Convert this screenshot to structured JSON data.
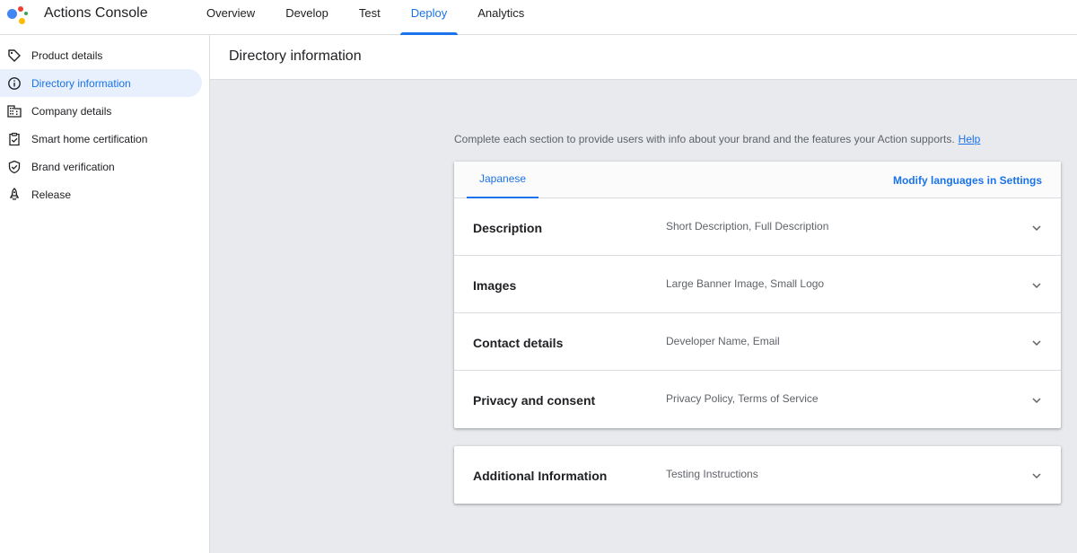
{
  "app": {
    "title": "Actions Console"
  },
  "nav": {
    "tabs": [
      {
        "label": "Overview"
      },
      {
        "label": "Develop"
      },
      {
        "label": "Test"
      },
      {
        "label": "Deploy",
        "active": true
      },
      {
        "label": "Analytics"
      }
    ]
  },
  "sidebar": {
    "items": [
      {
        "label": "Product details",
        "icon": "tag-icon"
      },
      {
        "label": "Directory information",
        "icon": "info-icon",
        "active": true
      },
      {
        "label": "Company details",
        "icon": "building-icon"
      },
      {
        "label": "Smart home certification",
        "icon": "clipboard-check-icon"
      },
      {
        "label": "Brand verification",
        "icon": "shield-check-icon"
      },
      {
        "label": "Release",
        "icon": "rocket-icon"
      }
    ]
  },
  "main": {
    "title": "Directory information",
    "intro_text": "Complete each section to provide users with info about your brand and the features your Action supports.",
    "help_link": "Help",
    "language_tab": "Japanese",
    "modify_languages": "Modify languages in Settings",
    "sections": [
      {
        "title": "Description",
        "summary": "Short Description, Full Description"
      },
      {
        "title": "Images",
        "summary": "Large Banner Image, Small Logo"
      },
      {
        "title": "Contact details",
        "summary": "Developer Name, Email"
      },
      {
        "title": "Privacy and consent",
        "summary": "Privacy Policy, Terms of Service"
      }
    ],
    "additional": {
      "title": "Additional Information",
      "summary": "Testing Instructions"
    }
  },
  "colors": {
    "accent": "#1a73e8",
    "active_bg": "#e8f0fe",
    "content_bg": "#e8eaed",
    "logo_blue": "#4285f4",
    "logo_red": "#ea4335",
    "logo_yellow": "#fbbc04",
    "logo_green": "#34a853"
  }
}
